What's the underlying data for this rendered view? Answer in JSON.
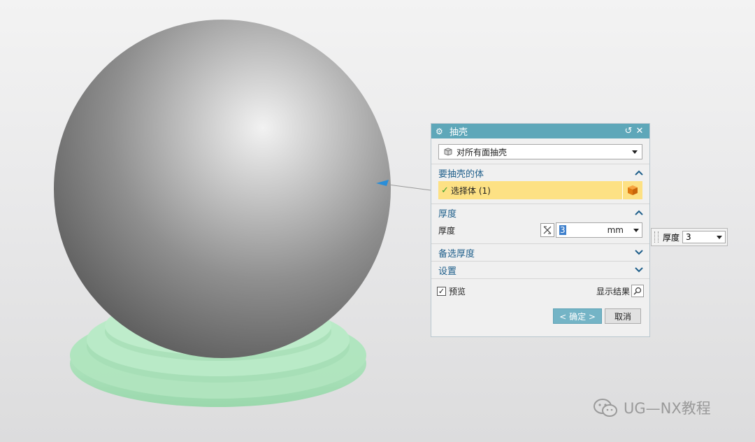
{
  "dialog": {
    "title": "抽壳",
    "type_select": {
      "value": "对所有面抽壳"
    },
    "body_section": {
      "title": "要抽壳的体",
      "select_label": "选择体 (1)"
    },
    "thickness_section": {
      "title": "厚度",
      "label": "厚度",
      "value": "3",
      "unit": "mm"
    },
    "alt_thickness_section": {
      "title": "备选厚度"
    },
    "settings_section": {
      "title": "设置"
    },
    "preview_label": "预览",
    "preview_checked": true,
    "show_result_label": "显示结果",
    "ok_label": "< 确定 >",
    "cancel_label": "取消"
  },
  "floating_thickness": {
    "label": "厚度",
    "value": "3"
  },
  "watermark": {
    "text": "UG—NX教程"
  },
  "colors": {
    "title_bar": "#5ea7b9",
    "section_text": "#1f5f8b",
    "selection_highlight": "#fde184",
    "ok_button": "#74b4c6",
    "base_green": "#9ee0b0"
  },
  "icons": {
    "dialog": "gear-icon",
    "reset": "reset-icon",
    "close": "close-icon",
    "type": "solid-body-icon",
    "select_body": "orange-cube-icon",
    "formula": "formula-icon",
    "show_result": "magnifier-icon",
    "watermark": "wechat-icon"
  }
}
